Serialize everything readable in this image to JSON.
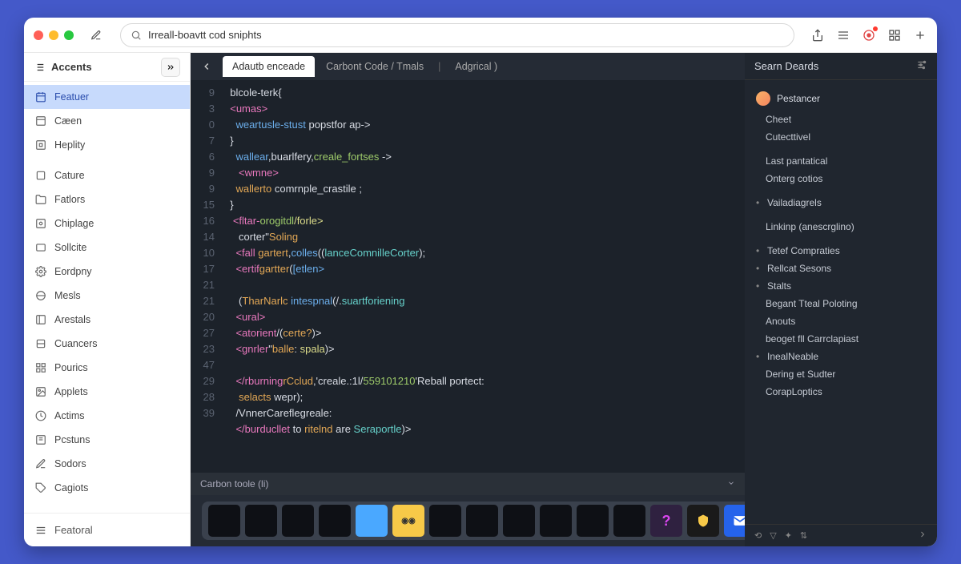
{
  "search": {
    "value": "Irreall-boavtt cod sniphts"
  },
  "sidebar": {
    "title": "Accents",
    "footer": "Featoral",
    "items": [
      {
        "label": "Featuer",
        "active": true
      },
      {
        "label": "Cæen"
      },
      {
        "label": "Heplity"
      },
      {
        "label": "Cature"
      },
      {
        "label": "Fatlors"
      },
      {
        "label": "Chiplage"
      },
      {
        "label": "Sollcite"
      },
      {
        "label": "Eordpny"
      },
      {
        "label": "Mesls"
      },
      {
        "label": "Arestals"
      },
      {
        "label": "Cuancers"
      },
      {
        "label": "Pourics"
      },
      {
        "label": "Applets"
      },
      {
        "label": "Actims"
      },
      {
        "label": "Pcstuns"
      },
      {
        "label": "Sodors"
      },
      {
        "label": "Cagiots"
      }
    ]
  },
  "tabs": [
    {
      "label": "Adautb enceade",
      "active": true
    },
    {
      "label": "Carbont Code / Tmals"
    },
    {
      "label": "Adgrical )"
    }
  ],
  "gutter": [
    "9",
    "3",
    "0",
    "7",
    "6",
    "9",
    "9",
    "15",
    "16",
    "14",
    "10",
    "17",
    "21",
    "21",
    "20",
    "27",
    "23",
    "",
    "47",
    "29",
    "28",
    "39"
  ],
  "code_lines": [
    [
      {
        "c": "",
        "t": "  blcole-terk{"
      }
    ],
    [
      {
        "c": "k-pk",
        "t": "  <umas>"
      }
    ],
    [
      {
        "c": "",
        "t": "    "
      },
      {
        "c": "k-bl",
        "t": "weartusle-stust"
      },
      {
        "c": "",
        "t": " popstfor ap->"
      }
    ],
    [
      {
        "c": "",
        "t": "  }"
      }
    ],
    [
      {
        "c": "",
        "t": "    "
      },
      {
        "c": "k-bl",
        "t": "wallear"
      },
      {
        "c": "",
        "t": ",buarlfery,"
      },
      {
        "c": "k-gr",
        "t": "creale_fortses"
      },
      {
        "c": "",
        "t": " ->"
      }
    ],
    [
      {
        "c": "k-pk",
        "t": "     <wmne>"
      }
    ],
    [
      {
        "c": "",
        "t": "    "
      },
      {
        "c": "k-or",
        "t": "wallerto"
      },
      {
        "c": "",
        "t": " comrnple_crastile ;"
      }
    ],
    [
      {
        "c": "",
        "t": "  }"
      }
    ],
    [
      {
        "c": "",
        "t": "   "
      },
      {
        "c": "k-pk",
        "t": "<fltar-"
      },
      {
        "c": "k-gr",
        "t": "orogitdl"
      },
      {
        "c": "k-yl",
        "t": "/forle>"
      }
    ],
    [
      {
        "c": "",
        "t": "     corter\""
      },
      {
        "c": "k-or",
        "t": "Soling"
      }
    ],
    [
      {
        "c": "",
        "t": "    "
      },
      {
        "c": "k-pk",
        "t": "<fall "
      },
      {
        "c": "k-or",
        "t": "gartert"
      },
      {
        "c": "",
        "t": ","
      },
      {
        "c": "k-bl",
        "t": "colles"
      },
      {
        "c": "",
        "t": "(("
      },
      {
        "c": "k-cy",
        "t": "lanceComnilleCorter"
      },
      {
        "c": "",
        "t": ");"
      }
    ],
    [
      {
        "c": "",
        "t": "    "
      },
      {
        "c": "k-pk",
        "t": "<ertif"
      },
      {
        "c": "k-or",
        "t": "gartter"
      },
      {
        "c": "",
        "t": "("
      },
      {
        "c": "k-bl",
        "t": "[etlen>"
      }
    ],
    [
      {
        "c": "",
        "t": ""
      }
    ],
    [
      {
        "c": "",
        "t": "     ("
      },
      {
        "c": "k-or",
        "t": "TharNarlc"
      },
      {
        "c": "",
        "t": " "
      },
      {
        "c": "k-bl",
        "t": "intespnal"
      },
      {
        "c": "",
        "t": "(/."
      },
      {
        "c": "k-cy",
        "t": "suartforiening"
      }
    ],
    [
      {
        "c": "k-pk",
        "t": "    <ural>"
      }
    ],
    [
      {
        "c": "",
        "t": "    "
      },
      {
        "c": "k-pk",
        "t": "<atorient"
      },
      {
        "c": "",
        "t": "/("
      },
      {
        "c": "k-or",
        "t": "certe?"
      },
      {
        "c": "",
        "t": ")>"
      }
    ],
    [
      {
        "c": "",
        "t": "    "
      },
      {
        "c": "k-pk",
        "t": "<gnrler"
      },
      {
        "c": "",
        "t": "\""
      },
      {
        "c": "k-or",
        "t": "balle"
      },
      {
        "c": "",
        "t": ": "
      },
      {
        "c": "k-yl",
        "t": "spala"
      },
      {
        "c": "",
        "t": ")>"
      }
    ],
    [
      {
        "c": "",
        "t": ""
      }
    ],
    [
      {
        "c": "",
        "t": "    "
      },
      {
        "c": "k-pk",
        "t": "</rburning"
      },
      {
        "c": "k-or",
        "t": "rCclud"
      },
      {
        "c": "",
        "t": ",'creale.:1l/"
      },
      {
        "c": "k-gr",
        "t": "559101210"
      },
      {
        "c": "",
        "t": "'Reball portect:"
      }
    ],
    [
      {
        "c": "",
        "t": "     "
      },
      {
        "c": "k-or",
        "t": "selacts"
      },
      {
        "c": "",
        "t": " wepr);"
      }
    ],
    [
      {
        "c": "",
        "t": "    /VnnerCareflegreale:"
      }
    ],
    [
      {
        "c": "",
        "t": "    "
      },
      {
        "c": "k-pk",
        "t": "</burducllet"
      },
      {
        "c": "",
        "t": " to "
      },
      {
        "c": "k-or",
        "t": "ritelnd"
      },
      {
        "c": "",
        "t": " are "
      },
      {
        "c": "k-cy",
        "t": "Seraportle"
      },
      {
        "c": "",
        "t": ")>"
      }
    ]
  ],
  "status": {
    "left": "Carbon toole (li)"
  },
  "right": {
    "title": "Searn Deards",
    "user": "Pestancer",
    "items": [
      {
        "t": "Cheet"
      },
      {
        "t": "Cutecttivel"
      },
      {
        "space": true
      },
      {
        "t": "Last pantatical"
      },
      {
        "t": "Onterg cotios"
      },
      {
        "space": true
      },
      {
        "t": "Vailadiagrels",
        "bullet": true
      },
      {
        "space": true
      },
      {
        "t": "Linkinp (anescrglino)"
      },
      {
        "space": true
      },
      {
        "t": "Tetef Compraties",
        "bullet": true
      },
      {
        "t": "Rellcat Sesons",
        "bullet": true
      },
      {
        "t": "Stalts",
        "bullet": true
      },
      {
        "t": "Begant Tteal Poloting"
      },
      {
        "t": "Anouts"
      },
      {
        "t": "beoget fll Carrclapiast"
      },
      {
        "t": "InealNeable",
        "bullet": true
      },
      {
        "t": "Dering et Sudter"
      },
      {
        "t": "CorapLoptics"
      }
    ]
  }
}
